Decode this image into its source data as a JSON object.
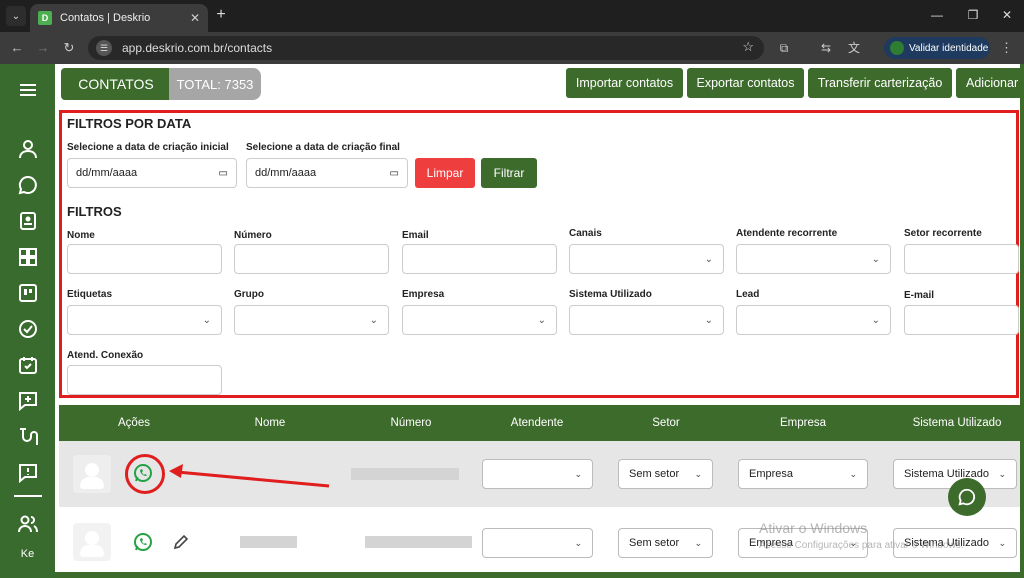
{
  "browser": {
    "tab_title": "Contatos | Deskrio",
    "favicon_letter": "D",
    "url": "app.deskrio.com.br/contacts",
    "validate_identity": "Validar identidade"
  },
  "sidebar": {
    "user_initials": "Ke"
  },
  "header": {
    "contatos_label": "CONTATOS",
    "total_label": "TOTAL: 7353",
    "buttons": {
      "import": "Importar contatos",
      "export": "Exportar contatos",
      "transfer": "Transferir carterização",
      "add": "Adicionar"
    }
  },
  "date_filters": {
    "title": "FILTROS POR DATA",
    "start_label": "Selecione a data de criação inicial",
    "end_label": "Selecione a data de criação final",
    "start_value": "dd/mm/aaaa",
    "end_value": "dd/mm/aaaa",
    "clear_button": "Limpar",
    "filter_button": "Filtrar"
  },
  "filters": {
    "title": "FILTROS",
    "nome": "Nome",
    "numero": "Número",
    "email": "Email",
    "canais": "Canais",
    "atendente_recorrente": "Atendente recorrente",
    "setor_recorrente": "Setor recorrente",
    "etiquetas": "Etiquetas",
    "grupo": "Grupo",
    "empresa": "Empresa",
    "sistema_utilizado": "Sistema Utilizado",
    "lead": "Lead",
    "e_mail": "E-mail",
    "atend_conexao": "Atend. Conexão"
  },
  "table": {
    "columns": [
      "Ações",
      "Nome",
      "Número",
      "Atendente",
      "Setor",
      "Empresa",
      "Sistema Utilizado"
    ],
    "rows": [
      {
        "setor": "Sem setor",
        "empresa": "Empresa",
        "sistema": "Sistema Utilizado"
      },
      {
        "setor": "Sem setor",
        "empresa": "Empresa",
        "sistema": "Sistema Utilizado"
      }
    ]
  },
  "watermark": {
    "title": "Ativar o Windows",
    "subtitle": "Acesse Configurações para ativar o Windows."
  },
  "colors": {
    "brand_green": "#3d6b2c",
    "highlight_red": "#e01e1e",
    "whatsapp_green": "#25a244"
  }
}
